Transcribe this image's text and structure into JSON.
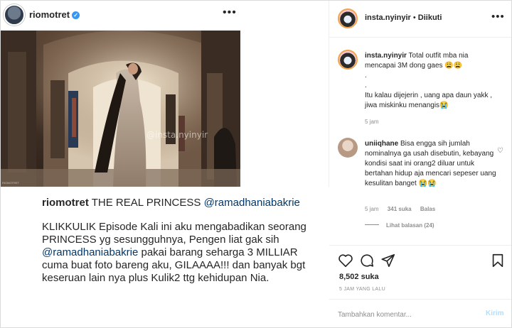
{
  "inner_post": {
    "username": "riomotret",
    "watermark": "@insta.nyinyir",
    "photo_credit": "RIOMOTRET",
    "caption_user": "riomotret",
    "caption_title": "THE REAL PRINCESS",
    "caption_mention": "@ramadhaniabakrie",
    "body_1": "KLIKKULIK Episode Kali ini aku mengabadikan seorang PRINCESS yg sesungguhnya, Pengen liat gak sih",
    "body_mention": "@ramadhaniabakrie",
    "body_2": "pakai barang seharga 3 MILLIAR cuma buat foto bareng aku, GILAAAA!!! dan banyak bgt keseruan lain nya plus Kulik2 ttg kehidupan Nia."
  },
  "sidebar": {
    "username": "insta.nyinyir",
    "follow_label": "Diikuti",
    "owner_comment": {
      "username": "insta.nyinyir",
      "text_1": "Total outfit mba nia mencapai 3M dong gaes",
      "emoji_1": "😩😩",
      "dot_1": ".",
      "dot_2": ".",
      "text_2": "Itu kalau dijejerin , uang apa daun yakk , jiwa miskinku menangis",
      "emoji_2": "😭",
      "time": "5 jam"
    },
    "comment": {
      "username": "uniiqhane",
      "text": "Bisa engga sih jumlah nominalnya ga usah disebutin, kebayang kondisi saat ini orang2 diluar untuk bertahan hidup aja mencari sepeser uang kesulitan banget",
      "emoji": "😭😭",
      "time": "5 jam",
      "likes": "341 suka",
      "reply_label": "Balas",
      "view_replies": "Lihat balasan (24)"
    },
    "likes_text": "8,502 suka",
    "timestamp": "5 JAM YANG LALU",
    "comment_placeholder": "Tambahkan komentar...",
    "post_label": "Kirim"
  }
}
